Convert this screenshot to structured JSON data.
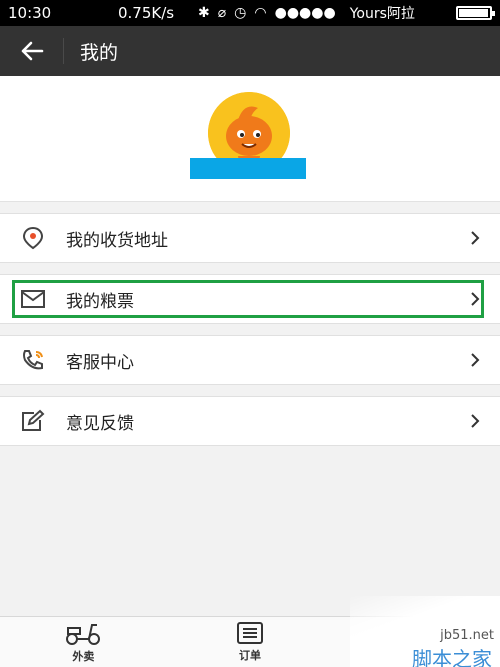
{
  "status_bar": {
    "time": "10:30",
    "speed": "0.75K/s",
    "carrier": "Yours阿拉",
    "signal_dots": "●●●●●"
  },
  "header": {
    "title": "我的",
    "back_icon": "back-arrow-icon"
  },
  "profile": {
    "avatar_icon": "mascot-avatar",
    "username_color": "#0aa6e6"
  },
  "menu": {
    "items": [
      {
        "label": "我的收货地址",
        "icon": "location-pin-icon"
      },
      {
        "label": "我的粮票",
        "icon": "envelope-icon"
      },
      {
        "label": "客服中心",
        "icon": "phone-icon"
      },
      {
        "label": "意见反馈",
        "icon": "edit-icon"
      }
    ],
    "chevron": ">"
  },
  "tabbar": {
    "tabs": [
      {
        "label": "外卖",
        "icon": "scooter-icon"
      },
      {
        "label": "订单",
        "icon": "order-list-icon"
      },
      {
        "label": "",
        "icon": "profile-icon"
      }
    ]
  },
  "watermark": {
    "site": "jb51.net",
    "name": "脚本之家"
  },
  "colors": {
    "header_bg": "#333333",
    "accent_blue": "#0aa6e6",
    "highlight_green": "#1fa043",
    "avatar_yellow": "#f9c21e"
  }
}
